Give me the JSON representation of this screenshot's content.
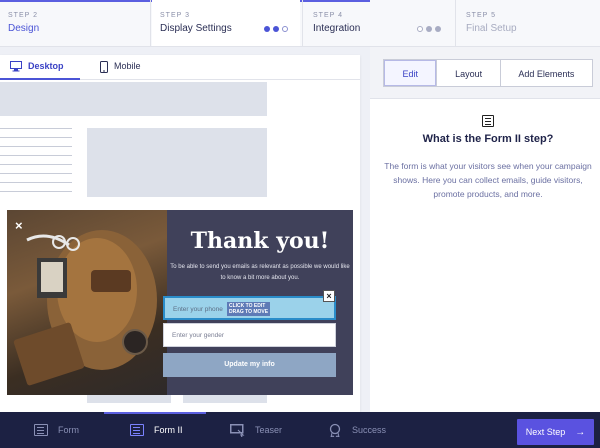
{
  "steps": [
    {
      "num": "STEP 2",
      "title": "Design"
    },
    {
      "num": "STEP 3",
      "title": "Display Settings"
    },
    {
      "num": "STEP 4",
      "title": "Integration"
    },
    {
      "num": "STEP 5",
      "title": "Final Setup"
    }
  ],
  "device_tabs": {
    "desktop": "Desktop",
    "mobile": "Mobile"
  },
  "popup": {
    "title": "Thank you!",
    "text": "To be able to send you emails as relevant as possible we would like to know a bit more about you.",
    "phone_placeholder": "Enter your phone",
    "gender_placeholder": "Enter your gender",
    "submit_label": "Update my info",
    "edit_tip_line1": "CLICK TO EDIT",
    "edit_tip_line2": "DRAG TO MOVE",
    "close_glyph": "×",
    "field_close_glyph": "×"
  },
  "right_panel": {
    "tabs": [
      "Edit",
      "Layout",
      "Add Elements"
    ],
    "title": "What is the Form II step?",
    "description": "The form is what your visitors see when your campaign shows. Here you can collect emails, guide visitors, promote products, and more."
  },
  "bottom": {
    "items": [
      "Form",
      "Form II",
      "Teaser",
      "Success"
    ],
    "next_label": "Next Step",
    "next_arrow": "→"
  },
  "colors": {
    "accent": "#5b5fe0",
    "dark": "#1c2143",
    "popup_bg": "#40415a"
  }
}
